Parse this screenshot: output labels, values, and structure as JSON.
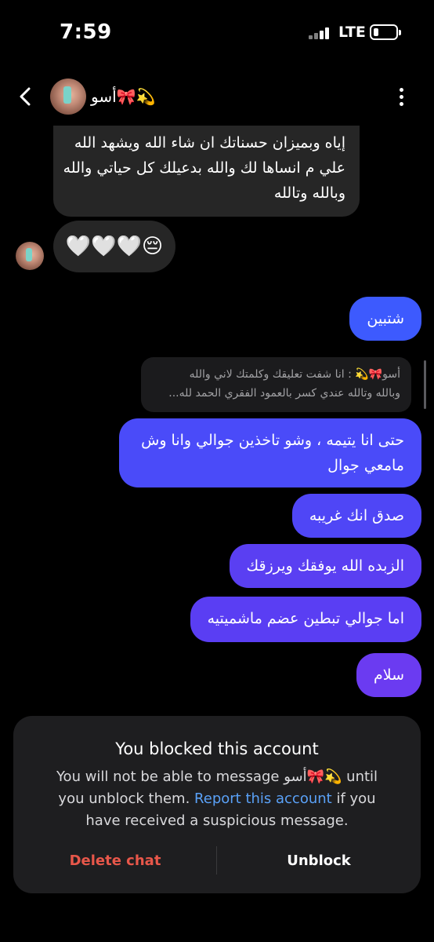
{
  "status_bar": {
    "time": "7:59",
    "network": "LTE"
  },
  "header": {
    "contact_name": "أسو🎀💫"
  },
  "messages": {
    "incoming_long": [
      "إياه وبميزان حسناتك ان شاء الله ويشهد الله",
      "علي م انساها لك والله بدعيلك كل حياتي والله",
      "وبالله وتالله"
    ],
    "incoming_hearts": "🤍🤍🤍😔",
    "out_1": "شتبين",
    "reply_quote": [
      "أسو🎀💫 : انا شفت تعليقك وكلمتك لاني والله",
      "وبالله وتالله عندي كسر بالعمود الفقري الحمد لله..."
    ],
    "out_2": [
      "حتى انا يتيمه ، وشو تاخذين جوالي وانا وش",
      "مامعي جوال"
    ],
    "out_3": "صدق انك غريبه",
    "out_4": "الزبده الله يوفقك ويرزقك",
    "out_5": "اما جوالي تبطين عضم ماشميتيه",
    "out_6": "سلام"
  },
  "blocked_panel": {
    "title": "You blocked this account",
    "line1": "You will not be able to message أسو🎀💫 until",
    "line2_pre": "you unblock them. ",
    "line2_link": "Report this account",
    "line2_post": " if you",
    "line3": "have received a suspicious message.",
    "delete_label": "Delete chat",
    "unblock_label": "Unblock"
  },
  "colors": {
    "incoming_bubble": "#262626",
    "outgoing_start": "#3d5afe",
    "outgoing_end": "#6b3bf1",
    "link": "#5aa1f7",
    "delete": "#e8574a"
  },
  "icons": [
    "back-chevron-icon",
    "more-options-icon",
    "signal-icon",
    "battery-icon"
  ]
}
